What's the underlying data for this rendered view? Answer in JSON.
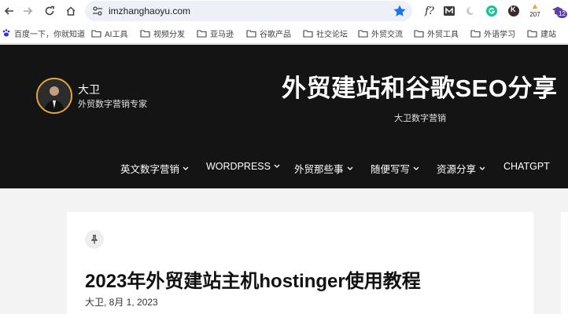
{
  "browser": {
    "url": "imzhanghaoyu.com",
    "extensions": {
      "formula_label": "f?",
      "badge_count": "207",
      "profile_badge": "12",
      "profile_letter": "K"
    }
  },
  "bookmarks": [
    {
      "label": "百度一下，你就知道",
      "icon": "paw-icon"
    },
    {
      "label": "AI工具",
      "icon": "folder-icon"
    },
    {
      "label": "视频分发",
      "icon": "folder-icon"
    },
    {
      "label": "亚马逊",
      "icon": "folder-icon"
    },
    {
      "label": "谷歌产品",
      "icon": "folder-icon"
    },
    {
      "label": "社交论坛",
      "icon": "folder-icon"
    },
    {
      "label": "外贸交流",
      "icon": "folder-icon"
    },
    {
      "label": "外贸工具",
      "icon": "folder-icon"
    },
    {
      "label": "外语学习",
      "icon": "folder-icon"
    },
    {
      "label": "建站",
      "icon": "folder-icon"
    }
  ],
  "site": {
    "brand_name": "大卫",
    "brand_tagline": "外贸数字营销专家",
    "hero_title": "外贸建站和谷歌SEO分享",
    "hero_subtitle": "大卫数字营销",
    "nav": [
      {
        "label": "英文数字营销",
        "dropdown": true
      },
      {
        "label": "WORDPRESS",
        "dropdown": true
      },
      {
        "label": "外贸那些事",
        "dropdown": true
      },
      {
        "label": "随便写写",
        "dropdown": true
      },
      {
        "label": "资源分享",
        "dropdown": true
      },
      {
        "label": "CHATGPT",
        "dropdown": false
      }
    ]
  },
  "article": {
    "title": "2023年外贸建站主机hostinger使用教程",
    "meta": "大卫, 8月 1, 2023"
  },
  "colors": {
    "header_bg": "#141414",
    "avatar_ring": "#e8a33c",
    "star": "#1a73e8",
    "grammarly": "#15c39a"
  }
}
